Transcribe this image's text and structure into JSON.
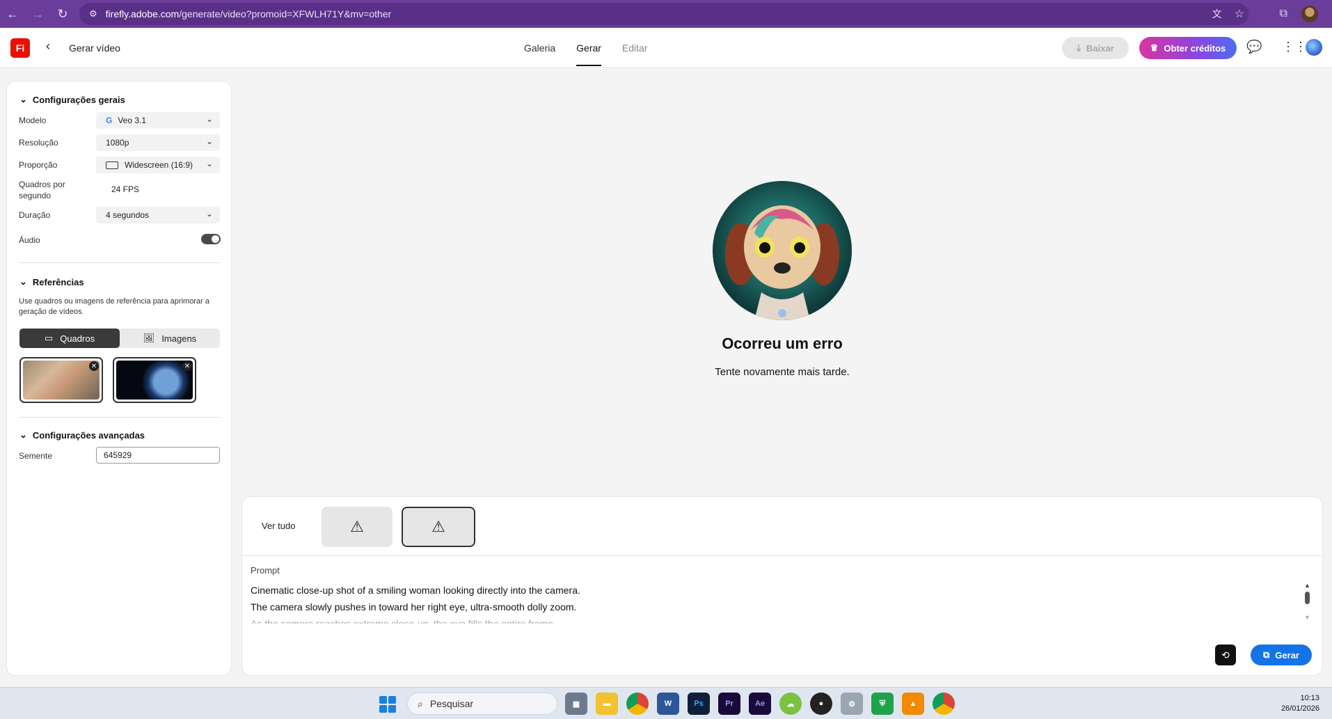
{
  "browser": {
    "url_host": "firefly.adobe.com",
    "url_path": "/generate/video?promoid=XFWLH71Y&mv=other"
  },
  "header": {
    "logo": "Fi",
    "title": "Gerar vídeo",
    "tabs": [
      {
        "label": "Galeria"
      },
      {
        "label": "Gerar"
      },
      {
        "label": "Editar"
      }
    ],
    "download_label": "Baixar",
    "credits_label": "Obter créditos"
  },
  "settings": {
    "general_title": "Configurações gerais",
    "model_label": "Modelo",
    "model_value": "Veo 3.1",
    "resolution_label": "Resolução",
    "resolution_value": "1080p",
    "ratio_label": "Proporção",
    "ratio_value": "Widescreen (16:9)",
    "fps_label": "Quadros por segundo",
    "fps_value": "24 FPS",
    "duration_label": "Duração",
    "duration_value": "4 segundos",
    "audio_label": "Áudio",
    "audio_on": true,
    "references_title": "Referências",
    "references_desc": "Use quadros ou imagens de referência para aprimorar a geração de vídeos.",
    "frames_label": "Quadros",
    "images_label": "Imagens",
    "advanced_title": "Configurações avançadas",
    "seed_label": "Semente",
    "seed_value": "645929"
  },
  "error": {
    "title": "Ocorreu um erro",
    "message": "Tente novamente mais tarde."
  },
  "bottom": {
    "see_all": "Ver tudo",
    "prompt_label": "Prompt",
    "prompt_line1": "Cinematic close-up shot of a smiling woman looking directly into the camera.",
    "prompt_line2": "The camera slowly pushes in toward her right eye, ultra-smooth dolly zoom.",
    "prompt_line3": "As the camera reaches extreme close-up, the eye fills the entire frame.",
    "generate_label": "Gerar"
  },
  "taskbar": {
    "search_placeholder": "Pesquisar",
    "time": "10:13",
    "date": "26/01/2026"
  },
  "colors": {
    "browser_bar": "#6a3d9a",
    "brand_red": "#eb1000",
    "generate_blue": "#1473e6"
  }
}
